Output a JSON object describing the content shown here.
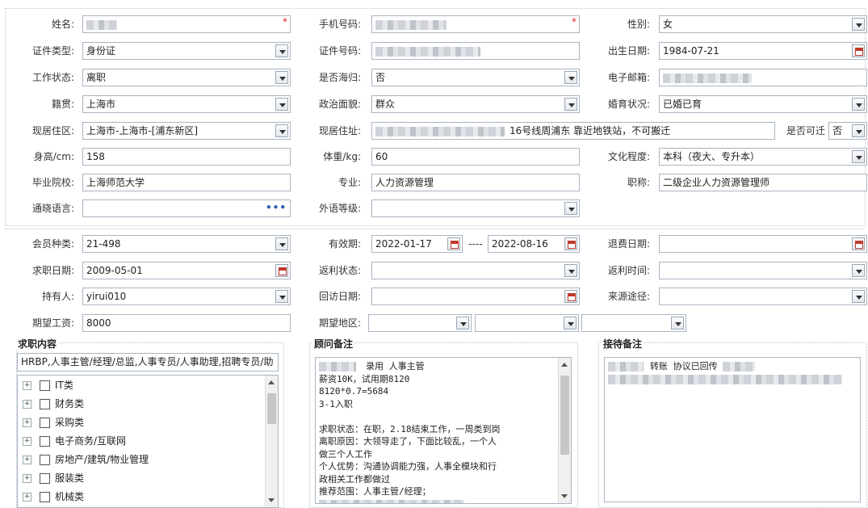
{
  "basic": {
    "name": {
      "label": "姓名:"
    },
    "phone": {
      "label": "手机号码:"
    },
    "gender": {
      "label": "性别:",
      "value": "女"
    },
    "id_type": {
      "label": "证件类型:",
      "value": "身份证"
    },
    "id_no": {
      "label": "证件号码:"
    },
    "birth": {
      "label": "出生日期:",
      "value": "1984-07-21"
    },
    "work_status": {
      "label": "工作状态:",
      "value": "离职"
    },
    "overseas": {
      "label": "是否海归:",
      "value": "否"
    },
    "email": {
      "label": "电子邮箱:"
    },
    "native": {
      "label": "籍贯:",
      "value": "上海市"
    },
    "politics": {
      "label": "政治面貌:",
      "value": "群众"
    },
    "marriage": {
      "label": "婚育状况:",
      "value": "已婚已育"
    },
    "residence": {
      "label": "现居住区:",
      "value": "上海市-上海市-[浦东新区]"
    },
    "address": {
      "label": "现居住址:",
      "value": "16号线周浦东 靠近地铁站，不可搬迁"
    },
    "relocate": {
      "label": "是否可迁",
      "value": "否"
    },
    "height": {
      "label": "身高/cm:",
      "value": "158"
    },
    "weight": {
      "label": "体重/kg:",
      "value": "60"
    },
    "education": {
      "label": "文化程度:",
      "value": "本科（夜大、专升本）"
    },
    "school": {
      "label": "毕业院校:",
      "value": "上海师范大学"
    },
    "major": {
      "label": "专业:",
      "value": "人力资源管理"
    },
    "title": {
      "label": "职称:",
      "value": "二级企业人力资源管理师"
    },
    "language": {
      "label": "通晓语言:",
      "value": ""
    },
    "lang_level": {
      "label": "外语等级:",
      "value": ""
    }
  },
  "member": {
    "type": {
      "label": "会员种类:",
      "value": "21-498"
    },
    "valid": {
      "label": "有效期:",
      "from": "2022-01-17",
      "sep": "----",
      "to": "2022-08-16"
    },
    "refund_date": {
      "label": "退费日期:",
      "value": ""
    },
    "apply_date": {
      "label": "求职日期:",
      "value": "2009-05-01"
    },
    "rebate_status": {
      "label": "返利状态:",
      "value": ""
    },
    "rebate_time": {
      "label": "返利时间:",
      "value": ""
    },
    "holder": {
      "label": "持有人:",
      "value": "yirui010"
    },
    "visit_date": {
      "label": "回访日期:",
      "value": ""
    },
    "source": {
      "label": "来源途径:",
      "value": ""
    },
    "salary": {
      "label": "期望工资:",
      "value": "8000"
    },
    "region": {
      "label": "期望地区:"
    }
  },
  "job_panel": {
    "title": "求职内容",
    "summary": "HRBP,人事主管/经理/总监,人事专员/人事助理,招聘专员/助",
    "tree": [
      "IT类",
      "财务类",
      "采购类",
      "电子商务/互联网",
      "房地产/建筑/物业管理",
      "服装类",
      "机械类"
    ]
  },
  "advisor_panel": {
    "title": "顾问备注",
    "lines": [
      {
        "pre": "",
        "text": "录用 人事主管",
        "blur": 46
      },
      {
        "pre": "",
        "text": "薪资10K，试用期8120",
        "blur": 0
      },
      {
        "pre": "",
        "text": "8120*0.7=5684",
        "blur": 0
      },
      {
        "pre": "",
        "text": "3-1入职",
        "blur": 0
      },
      {
        "pre": "",
        "text": "",
        "blur": 0
      },
      {
        "pre": "",
        "text": "求职状态：在职，2.18结束工作，一周类到岗",
        "blur": 0
      },
      {
        "pre": "",
        "text": "离职原因：大领导走了，下面比较乱，一个人",
        "blur": 0
      },
      {
        "pre": "",
        "text": "做三个人工作",
        "blur": 0
      },
      {
        "pre": "",
        "text": "个人优势：沟通协调能力强，人事全模块和行",
        "blur": 0
      },
      {
        "pre": "",
        "text": "政相关工作都做过",
        "blur": 0
      },
      {
        "pre": "",
        "text": "推荐范围：人事主管/经理；",
        "blur": 0
      }
    ]
  },
  "reception_panel": {
    "title": "接待备注",
    "line1": "转账 协议已回传"
  }
}
